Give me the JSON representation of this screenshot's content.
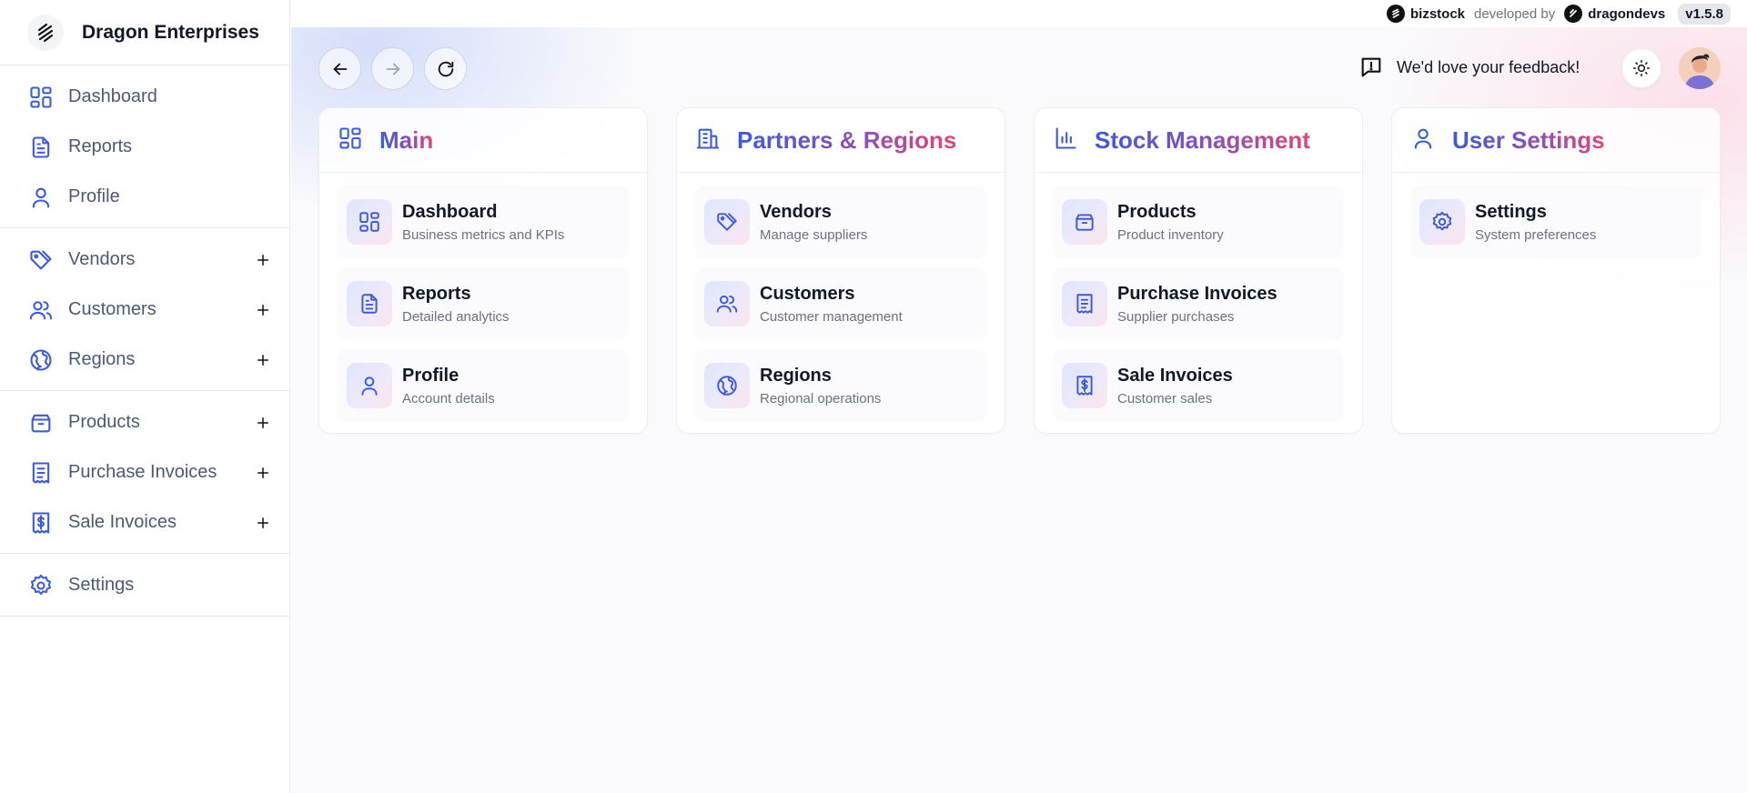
{
  "brand": {
    "name": "Dragon Enterprises"
  },
  "sidebar": {
    "groups": [
      [
        {
          "label": "Dashboard",
          "icon": "dashboard-icon",
          "expandable": false
        },
        {
          "label": "Reports",
          "icon": "document-icon",
          "expandable": false
        },
        {
          "label": "Profile",
          "icon": "user-icon",
          "expandable": false
        }
      ],
      [
        {
          "label": "Vendors",
          "icon": "tag-icon",
          "expandable": true
        },
        {
          "label": "Customers",
          "icon": "users-icon",
          "expandable": true
        },
        {
          "label": "Regions",
          "icon": "globe-icon",
          "expandable": true
        }
      ],
      [
        {
          "label": "Products",
          "icon": "box-icon",
          "expandable": true
        },
        {
          "label": "Purchase Invoices",
          "icon": "receipt-icon",
          "expandable": true
        },
        {
          "label": "Sale Invoices",
          "icon": "dollar-receipt-icon",
          "expandable": true
        }
      ],
      [
        {
          "label": "Settings",
          "icon": "gear-icon",
          "expandable": false
        }
      ]
    ]
  },
  "topbar": {
    "product": "bizstock",
    "developed_by": "developed by",
    "developer": "dragondevs",
    "version": "v1.5.8"
  },
  "header": {
    "feedback": "We'd love your feedback!"
  },
  "cards": [
    {
      "title": "Main",
      "icon": "dashboard-icon",
      "items": [
        {
          "title": "Dashboard",
          "desc": "Business metrics and KPIs",
          "icon": "dashboard-icon"
        },
        {
          "title": "Reports",
          "desc": "Detailed analytics",
          "icon": "document-icon"
        },
        {
          "title": "Profile",
          "desc": "Account details",
          "icon": "user-icon"
        }
      ]
    },
    {
      "title": "Partners & Regions",
      "icon": "building-icon",
      "items": [
        {
          "title": "Vendors",
          "desc": "Manage suppliers",
          "icon": "tag-icon"
        },
        {
          "title": "Customers",
          "desc": "Customer management",
          "icon": "users-icon"
        },
        {
          "title": "Regions",
          "desc": "Regional operations",
          "icon": "globe-icon"
        }
      ]
    },
    {
      "title": "Stock Management",
      "icon": "bar-chart-icon",
      "items": [
        {
          "title": "Products",
          "desc": "Product inventory",
          "icon": "box-icon"
        },
        {
          "title": "Purchase Invoices",
          "desc": "Supplier purchases",
          "icon": "receipt-icon"
        },
        {
          "title": "Sale Invoices",
          "desc": "Customer sales",
          "icon": "dollar-receipt-icon"
        }
      ]
    },
    {
      "title": "User Settings",
      "icon": "user-icon",
      "items": [
        {
          "title": "Settings",
          "desc": "System preferences",
          "icon": "gear-icon"
        }
      ]
    }
  ],
  "colors": {
    "accent": "#3b5bdb",
    "gradient_end": "#e2457a",
    "sidebar_text": "#4b5a74"
  }
}
